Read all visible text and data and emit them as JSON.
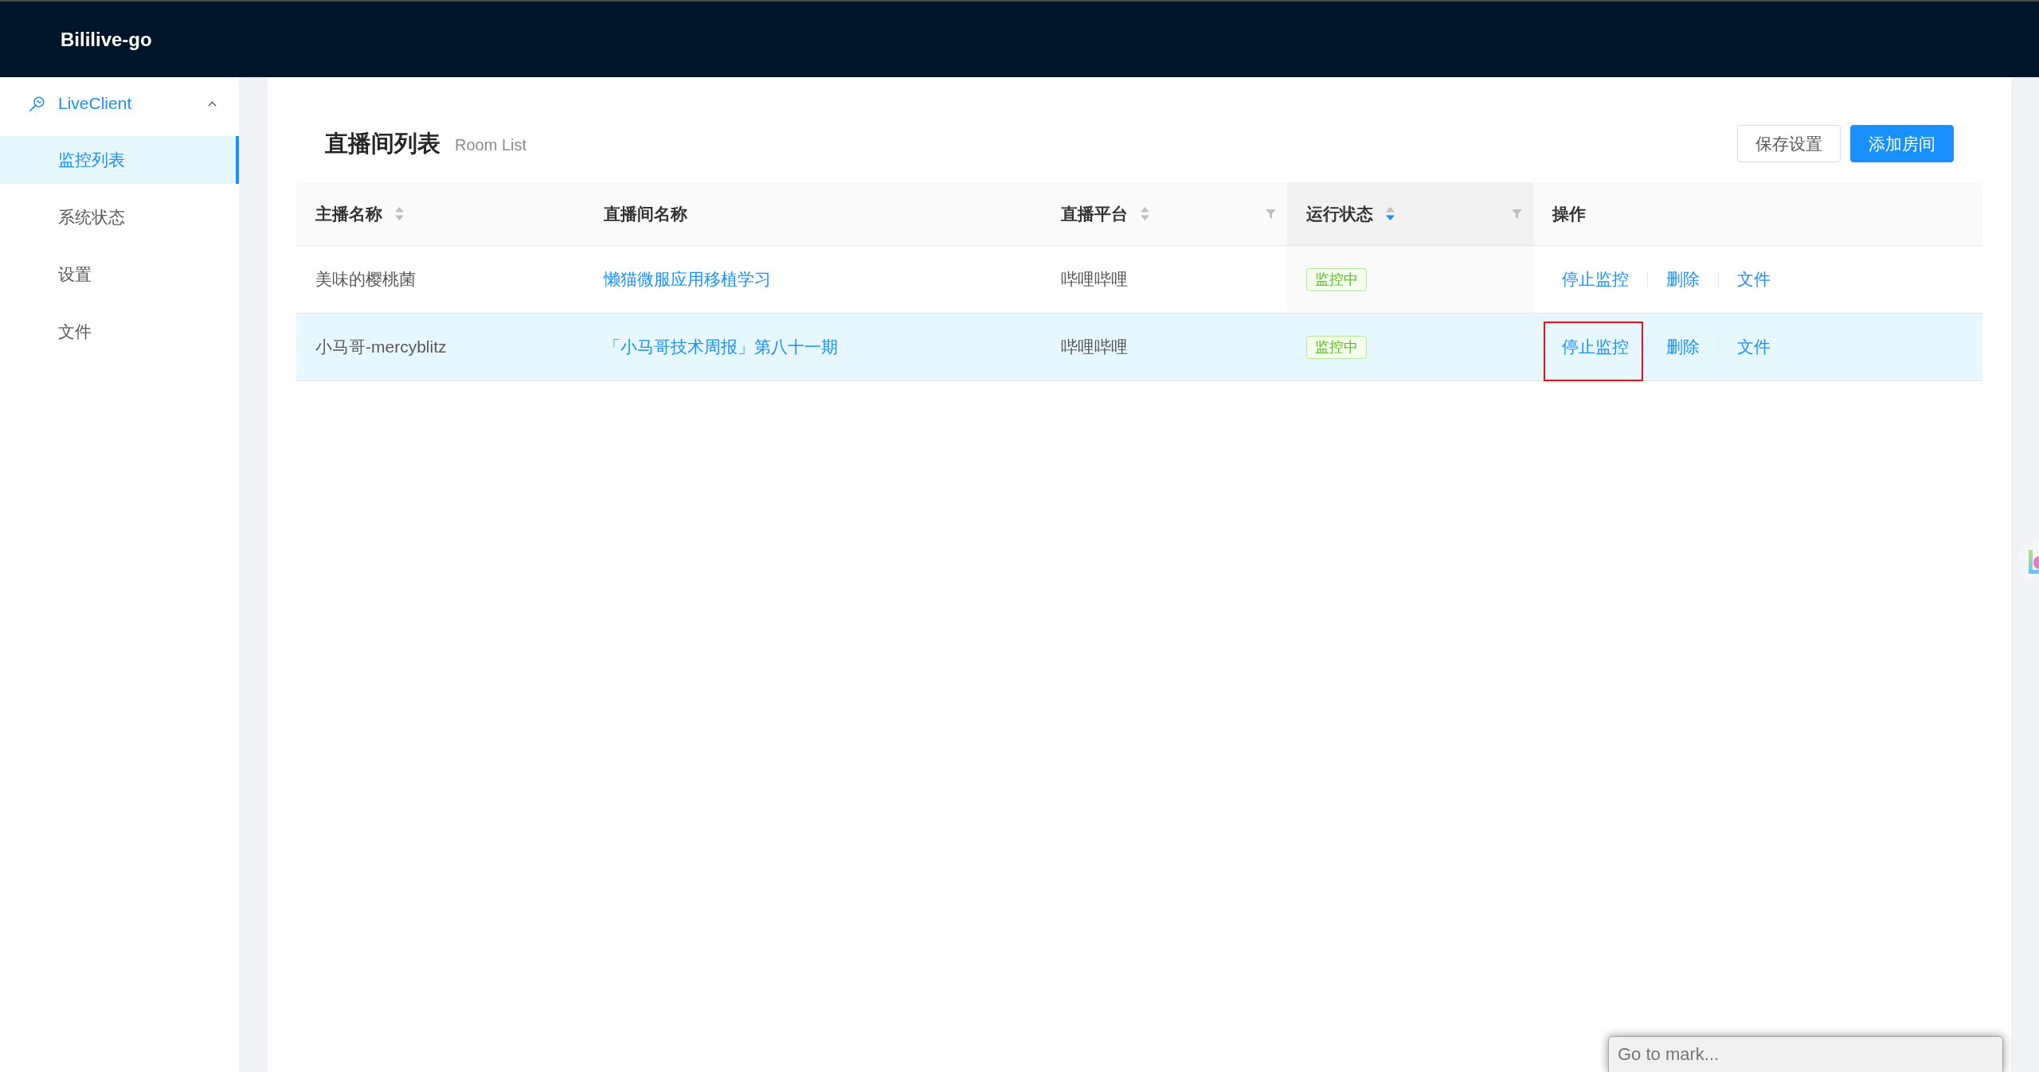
{
  "header": {
    "logo": "Bililive-go"
  },
  "sidebar": {
    "group": {
      "label": "LiveClient",
      "expanded": true
    },
    "items": [
      {
        "label": "监控列表",
        "selected": true
      },
      {
        "label": "系统状态",
        "selected": false
      },
      {
        "label": "设置",
        "selected": false
      },
      {
        "label": "文件",
        "selected": false
      }
    ]
  },
  "page_header": {
    "title": "直播间列表",
    "subtitle": "Room List",
    "buttons": [
      {
        "label": "保存设置",
        "kind": "default"
      },
      {
        "label": "添加房间",
        "kind": "primary"
      }
    ]
  },
  "table": {
    "columns": [
      {
        "label": "主播名称",
        "sorter": {
          "ascending": false,
          "descending": false
        },
        "filter": false
      },
      {
        "label": "直播间名称",
        "filter": false
      },
      {
        "label": "直播平台",
        "sorter": {
          "ascending": false,
          "descending": false
        },
        "filter": true
      },
      {
        "label": "运行状态",
        "sorter": {
          "ascending": false,
          "descending": true
        },
        "filter": true
      },
      {
        "label": "操作",
        "filter": false
      }
    ],
    "rows": [
      {
        "selected": false,
        "host": "美味的樱桃菌",
        "room": "懒猫微服应用移植学习",
        "platform": "哔哩哔哩",
        "status": "监控中",
        "actions": [
          {
            "label": "停止监控",
            "highlighted": false
          },
          {
            "label": "删除",
            "highlighted": false
          },
          {
            "label": "文件",
            "highlighted": false
          }
        ]
      },
      {
        "selected": true,
        "host": "小马哥-mercyblitz",
        "room": "「小马哥技术周报」第八十一期",
        "platform": "哔哩哔哩",
        "status": "监控中",
        "actions": [
          {
            "label": "停止监控",
            "highlighted": true
          },
          {
            "label": "删除",
            "highlighted": false
          },
          {
            "label": "文件",
            "highlighted": false
          }
        ]
      }
    ]
  },
  "mark_search": {
    "placeholder": "Go to mark..."
  }
}
